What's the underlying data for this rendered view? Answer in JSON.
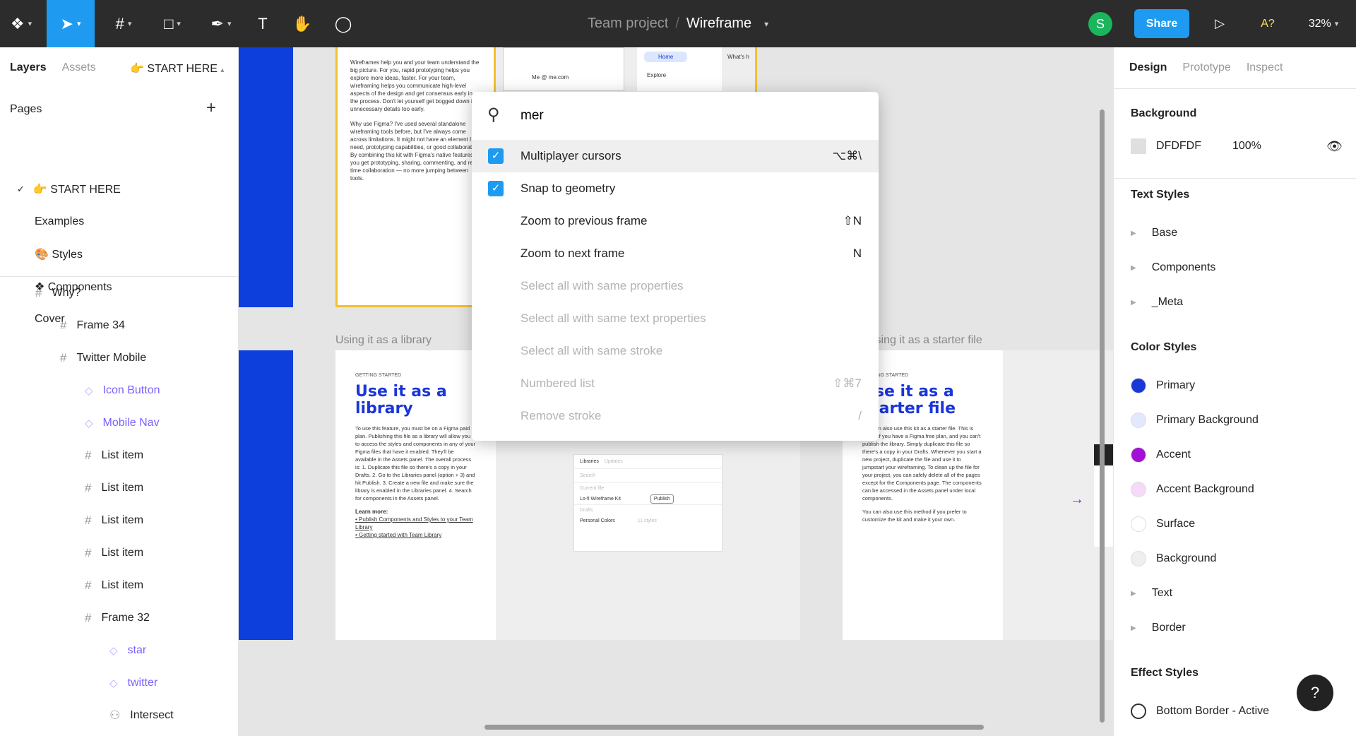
{
  "topbar": {
    "project": "Team project",
    "separator": "/",
    "file": "Wireframe",
    "avatar_initial": "S",
    "share": "Share",
    "accessibility": "A?",
    "zoom": "32%"
  },
  "left": {
    "tabs": [
      "Layers",
      "Assets"
    ],
    "page_select": "👉 START HERE",
    "pages_label": "Pages",
    "pages": [
      "👉 START HERE",
      "Examples",
      "🎨 Styles",
      "❖ Components",
      "Cover"
    ],
    "layers": [
      {
        "name": "Why?",
        "type": "frame",
        "depth": 0
      },
      {
        "name": "Frame 34",
        "type": "frame",
        "depth": 1
      },
      {
        "name": "Twitter Mobile",
        "type": "frame",
        "depth": 1
      },
      {
        "name": "Icon Button",
        "type": "component",
        "depth": 2
      },
      {
        "name": "Mobile Nav",
        "type": "component",
        "depth": 2
      },
      {
        "name": "List item",
        "type": "frame",
        "depth": 2
      },
      {
        "name": "List item",
        "type": "frame",
        "depth": 2
      },
      {
        "name": "List item",
        "type": "frame",
        "depth": 2
      },
      {
        "name": "List item",
        "type": "frame",
        "depth": 2
      },
      {
        "name": "List item",
        "type": "frame",
        "depth": 2
      },
      {
        "name": "Frame 32",
        "type": "frame",
        "depth": 2
      },
      {
        "name": "star",
        "type": "component",
        "depth": 3
      },
      {
        "name": "twitter",
        "type": "component",
        "depth": 3
      },
      {
        "name": "Intersect",
        "type": "shape",
        "depth": 3
      }
    ]
  },
  "right": {
    "tabs": [
      "Design",
      "Prototype",
      "Inspect"
    ],
    "background_label": "Background",
    "bg_hex": "DFDFDF",
    "bg_opacity": "100%",
    "text_styles_label": "Text Styles",
    "text_styles": [
      "Base",
      "Components",
      "_Meta"
    ],
    "color_styles_label": "Color Styles",
    "color_styles": [
      {
        "name": "Primary",
        "color": "#1939d6",
        "group": false
      },
      {
        "name": "Primary Background",
        "color": "#e3e9fd",
        "group": false
      },
      {
        "name": "Accent",
        "color": "#a30fd6",
        "group": false
      },
      {
        "name": "Accent Background",
        "color": "#f6d9f7",
        "group": false
      },
      {
        "name": "Surface",
        "color": "#ffffff",
        "group": false
      },
      {
        "name": "Background",
        "color": "#efefef",
        "group": false
      },
      {
        "name": "Text",
        "group": true
      },
      {
        "name": "Border",
        "group": true
      }
    ],
    "effect_styles_label": "Effect Styles",
    "effect_styles": [
      "Bottom Border - Active"
    ],
    "help": "?"
  },
  "palette": {
    "query": "mer",
    "items": [
      {
        "label": "Multiplayer cursors",
        "shortcut": "⌥⌘\\",
        "checked": true,
        "enabled": true,
        "highlight": true
      },
      {
        "label": "Snap to geometry",
        "shortcut": "",
        "checked": true,
        "enabled": true
      },
      {
        "label": "Zoom to previous frame",
        "shortcut": "⇧N",
        "enabled": true
      },
      {
        "label": "Zoom to next frame",
        "shortcut": "N",
        "enabled": true
      },
      {
        "label": "Select all with same properties",
        "shortcut": "",
        "enabled": false
      },
      {
        "label": "Select all with same text properties",
        "shortcut": "",
        "enabled": false
      },
      {
        "label": "Select all with same stroke",
        "shortcut": "",
        "enabled": false
      },
      {
        "label": "Numbered list",
        "shortcut": "⇧⌘7",
        "enabled": false
      },
      {
        "label": "Remove stroke",
        "shortcut": "/",
        "enabled": false
      }
    ]
  },
  "canvas": {
    "label_library": "Using it as a library",
    "label_starter": "Using it as a starter file",
    "why_text": "Wireframes help you and your team understand the big picture. For you, rapid prototyping helps you explore more ideas, faster. For your team, wireframing helps you communicate high-level aspects of the design and get consensus early in the process. Don't let yourself get bogged down in unnecessary details too early.",
    "why_figma": "Why use Figma? I've used several standalone wireframing tools before, but I've always come across limitations. It might not have an element I need, prototyping capabilities, or good collaboration. By combining this kit with Figma's native features, you get prototyping, sharing, commenting, and real time collaboration — no more jumping between tools.",
    "mock_user": "Me @ me.com",
    "mock_home": "Home",
    "mock_explore": "Explore",
    "mock_whats": "What's h",
    "eyebrow": "GETTING STARTED",
    "lib_title": "Use it as a library",
    "lib_text": "To use this feature, you must be on a Figma paid plan. Publishing this file as a library will allow you to access the styles and components in any of your Figma files that have it enabled. They'll be available in the Assets panel. The overall process is: 1. Duplicate this file so there's a copy in your Drafts. 2. Go to the Libraries panel (option + 3) and hit Publish. 3. Create a new file and make sure the library is enabled in the Libraries panel. 4. Search for components in the Assets panel.",
    "lib_learn": "Learn more:",
    "lib_link1": "• Publish Components and Styles to your Team Library",
    "lib_link2": "• Getting started with Team Library",
    "libpanel": {
      "tab1": "Libraries",
      "tab2": "Updates",
      "search": "Search",
      "current": "Current file",
      "kit": "Lo-fi Wireframe Kit",
      "publish": "Publish",
      "drafts": "Drafts",
      "colors": "Personal Colors",
      "styles": "11 styles"
    },
    "starter_title": "Use it as a starter file",
    "starter_text": "You can also use this kit as a starter file. This is useful if you have a Figma free plan, and you can't publish the library. Simply duplicate this file so there's a copy in your Drafts. Whenever you start a new project, duplicate the file and use it to jumpstart your wireframing. To clean up the file for your project, you can safely delete all of the pages except for the Components page. The components can be accessed in the Assets panel under local components.",
    "starter_text2": "You can also use this method if you prefer to customize the kit and make it your own."
  },
  "colors": {
    "accent": "#1e9bf0",
    "canvas": "#DFDFDF",
    "frame_highlight": "#f2c12e",
    "brand_blue": "#1939d6",
    "avatar": "#1bb55c"
  }
}
